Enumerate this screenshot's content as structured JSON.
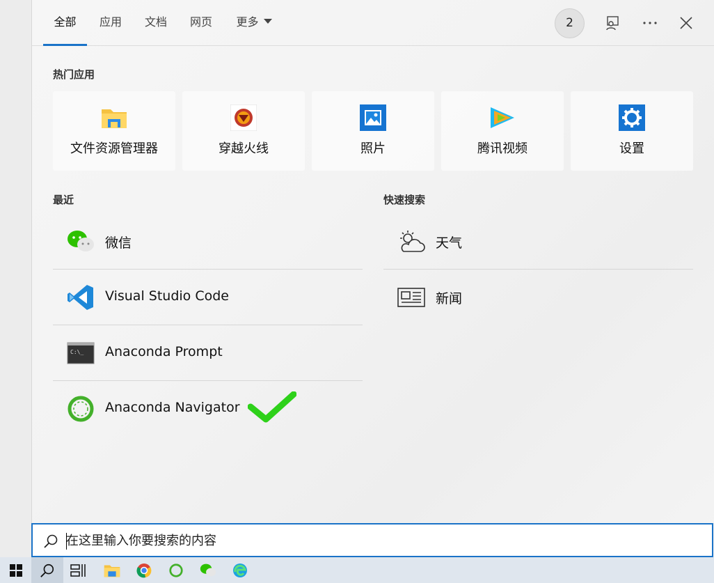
{
  "tabs": [
    {
      "label": "全部",
      "active": true
    },
    {
      "label": "应用"
    },
    {
      "label": "文档"
    },
    {
      "label": "网页"
    },
    {
      "label": "更多"
    }
  ],
  "header": {
    "points_badge": "2",
    "icons": [
      "feedback-icon",
      "more-icon",
      "close-icon"
    ]
  },
  "top_apps": {
    "title": "热门应用",
    "items": [
      {
        "label": "文件资源管理器",
        "icon": "folder-icon"
      },
      {
        "label": "穿越火线",
        "icon": "crossfire-icon"
      },
      {
        "label": "照片",
        "icon": "photos-icon"
      },
      {
        "label": "腾讯视频",
        "icon": "tencent-video-icon"
      },
      {
        "label": "设置",
        "icon": "gear-icon"
      }
    ]
  },
  "recent": {
    "title": "最近",
    "items": [
      {
        "label": "微信",
        "icon": "wechat-icon"
      },
      {
        "label": "Visual Studio Code",
        "icon": "vscode-icon"
      },
      {
        "label": "Anaconda Prompt",
        "icon": "terminal-icon"
      },
      {
        "label": "Anaconda Navigator",
        "icon": "anaconda-icon"
      }
    ]
  },
  "quick_search": {
    "title": "快速搜索",
    "items": [
      {
        "label": "天气",
        "icon": "weather-icon"
      },
      {
        "label": "新闻",
        "icon": "news-icon"
      }
    ]
  },
  "search": {
    "placeholder": "在这里输入你要搜索的内容"
  },
  "annotation": {
    "type": "checkmark",
    "color": "#2ed11a"
  },
  "taskbar": [
    "windows-start-icon",
    "search-icon",
    "task-view-icon",
    "file-explorer-icon",
    "chrome-icon",
    "anaconda-icon",
    "wechat-icon",
    "edge-icon"
  ]
}
